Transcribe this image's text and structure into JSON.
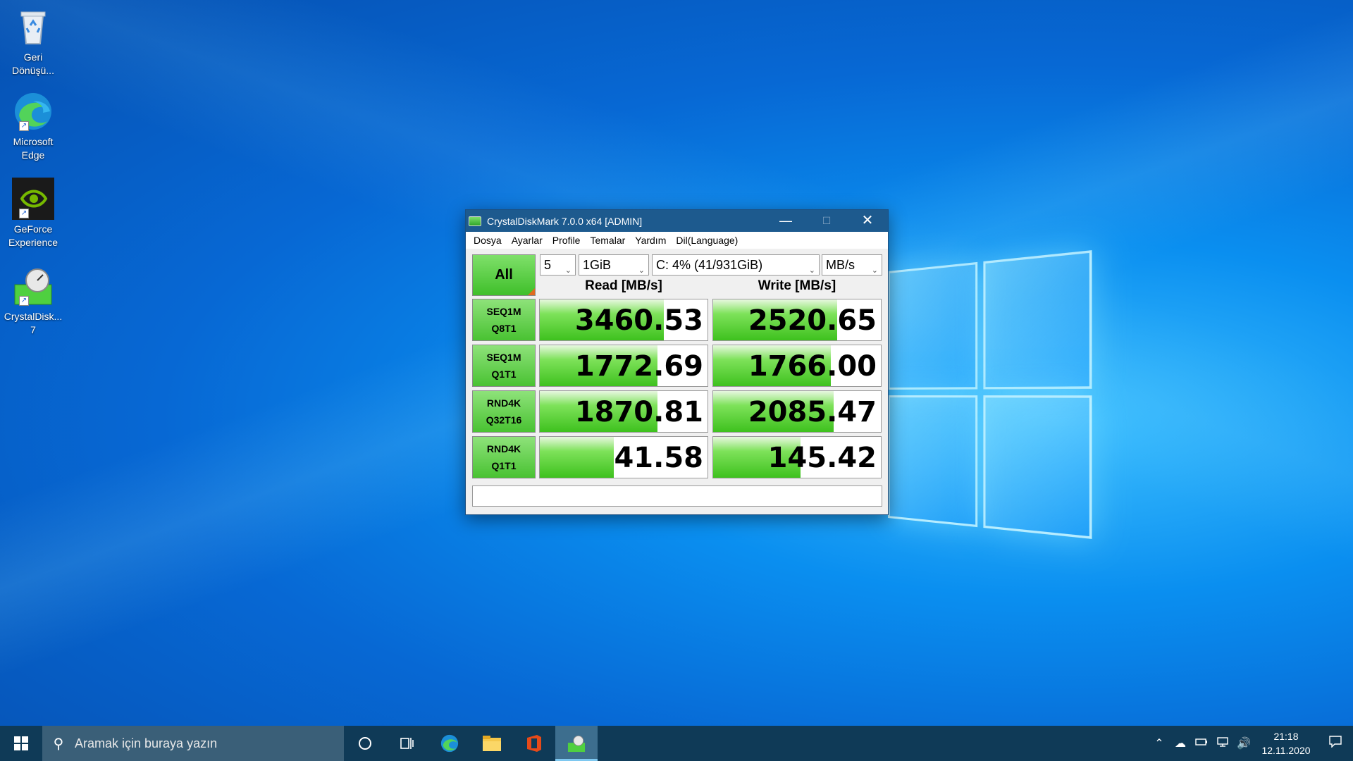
{
  "desktop": {
    "icons": [
      {
        "label": "Geri Dönüşü...",
        "icon": "recycle-bin-icon"
      },
      {
        "label": "Microsoft Edge",
        "icon": "edge-icon"
      },
      {
        "label": "GeForce Experience",
        "icon": "geforce-icon"
      },
      {
        "label": "CrystalDisk... 7",
        "icon": "crystaldisk-icon"
      }
    ]
  },
  "window": {
    "title": "CrystalDiskMark 7.0.0 x64 [ADMIN]",
    "controls": {
      "minimize": "—",
      "maximize": "☐",
      "close": "✕"
    },
    "menu": [
      "Dosya",
      "Ayarlar",
      "Profile",
      "Temalar",
      "Yardım",
      "Dil(Language)"
    ],
    "all_button": "All",
    "count": "5",
    "size": "1GiB",
    "drive": "C: 4% (41/931GiB)",
    "unit": "MB/s",
    "read_header": "Read [MB/s]",
    "write_header": "Write [MB/s]",
    "tests": [
      {
        "line1": "SEQ1M",
        "line2": "Q8T1",
        "read": "3460.53",
        "write": "2520.65",
        "read_fill": 0.74,
        "write_fill": 0.74
      },
      {
        "line1": "SEQ1M",
        "line2": "Q1T1",
        "read": "1772.69",
        "write": "1766.00",
        "read_fill": 0.7,
        "write_fill": 0.7
      },
      {
        "line1": "RND4K",
        "line2": "Q32T16",
        "read": "1870.81",
        "write": "2085.47",
        "read_fill": 0.7,
        "write_fill": 0.72
      },
      {
        "line1": "RND4K",
        "line2": "Q1T1",
        "read": "41.58",
        "write": "145.42",
        "read_fill": 0.44,
        "write_fill": 0.52
      }
    ],
    "status": "",
    "colors": {
      "bar": "#3ec11e",
      "titlebar": "#1d5a8e"
    }
  },
  "taskbar": {
    "search_placeholder": "Aramak için buraya yazın",
    "apps": [
      "cortana-icon",
      "task-view-icon",
      "edge-icon",
      "file-explorer-icon",
      "office-icon",
      "crystaldiskmark-icon"
    ],
    "time": "21:18",
    "date": "12.11.2020"
  }
}
